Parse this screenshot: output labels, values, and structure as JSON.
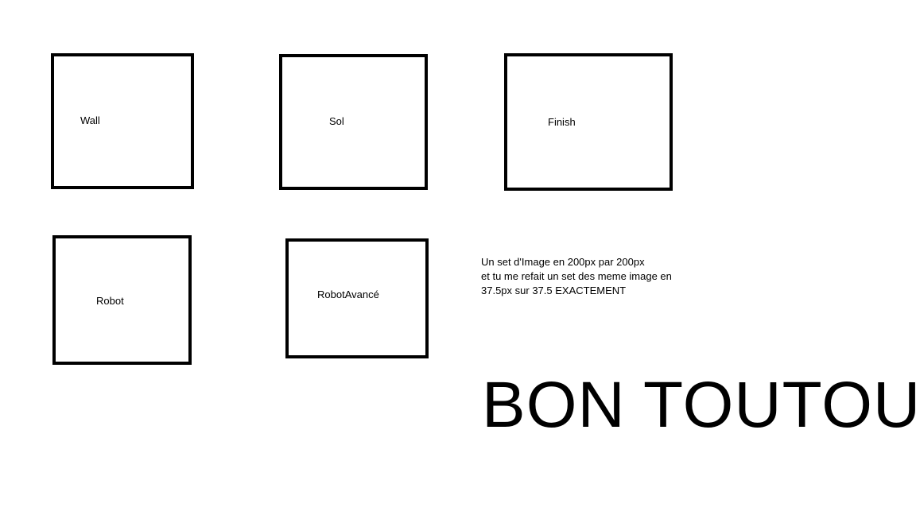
{
  "boxes": {
    "wall": {
      "label": "Wall"
    },
    "sol": {
      "label": "Sol"
    },
    "finish": {
      "label": "Finish"
    },
    "robot": {
      "label": "Robot"
    },
    "robot_avance": {
      "label": "RobotAvancé"
    }
  },
  "note": {
    "lines": [
      "Un set d'Image en  200px par 200px",
      "et tu me refait un set des meme image en",
      "37.5px sur 37.5 EXACTEMENT"
    ]
  },
  "headline": "BON TOUTOU"
}
